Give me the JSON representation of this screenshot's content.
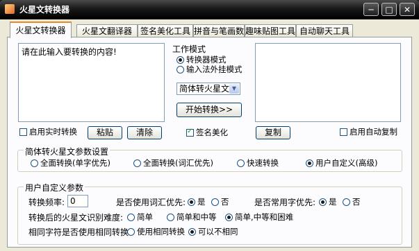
{
  "window": {
    "title": "火星文转换器",
    "minimize": "─",
    "maximize": "□",
    "close": "✕"
  },
  "tabs": [
    "火星文转换器",
    "火星文翻译器",
    "签名美化工具",
    "拼音与笔画数",
    "趣味贴图工具",
    "自动聊天工具"
  ],
  "input": {
    "placeholder_text": "请在此输入要转换的内容!"
  },
  "work_mode": {
    "title": "工作模式",
    "options": [
      {
        "label": "转换器模式",
        "selected": true
      },
      {
        "label": "输入法外挂模式",
        "selected": false
      }
    ]
  },
  "conversion_select": {
    "value": "简体转火星文"
  },
  "buttons": {
    "start": "开始转换>>",
    "paste": "粘贴",
    "clear": "清除",
    "copy": "复制"
  },
  "checkboxes": {
    "realtime": {
      "label": "启用实时转换",
      "checked": false
    },
    "signature": {
      "label": "签名美化",
      "checked": true
    },
    "autocopy": {
      "label": "启用自动复制",
      "checked": false
    }
  },
  "params": {
    "title": "简体转火星文参数设置",
    "options": [
      {
        "label": "全面转换(单字优先)",
        "selected": false
      },
      {
        "label": "全面转换(词汇优先)",
        "selected": false
      },
      {
        "label": "快速转换",
        "selected": false
      },
      {
        "label": "用户自定义(高级)",
        "selected": true
      }
    ]
  },
  "user_params": {
    "title": "用户自定义参数",
    "frequency_label": "转换频率:",
    "frequency_value": "0",
    "use_vocab_label": "是否使用词汇优先:",
    "use_vocab_options": [
      {
        "label": "是",
        "selected": true
      },
      {
        "label": "否",
        "selected": false
      }
    ],
    "common_char_label": "是否常用字优先:",
    "common_char_options": [
      {
        "label": "是",
        "selected": true
      },
      {
        "label": "否",
        "selected": false
      }
    ],
    "difficulty_label": "转换后的火星文识别难度:",
    "difficulty_options": [
      {
        "label": "简单",
        "selected": false
      },
      {
        "label": "简单和中等",
        "selected": false
      },
      {
        "label": "简单,中等和困难",
        "selected": true
      }
    ],
    "same_char_label": "相同字符是否使用相同转换:",
    "same_char_options": [
      {
        "label": "使用相同转换",
        "selected": false
      },
      {
        "label": "可以不相同",
        "selected": true
      }
    ]
  }
}
